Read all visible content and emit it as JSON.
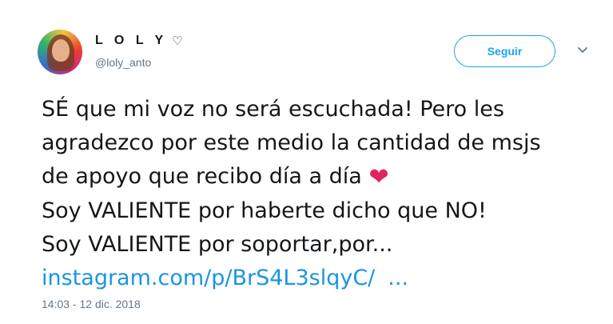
{
  "user": {
    "display_name": "L O L Y",
    "name_suffix_icon": "heart-outline-icon",
    "handle": "@loly_anto"
  },
  "follow_button": {
    "label": "Seguir"
  },
  "menu_icon": "chevron-down-icon",
  "tweet": {
    "lines": [
      "SÉ que mi voz no será escuchada! Pero les",
      "agradezco por este medio la cantidad de msjs",
      "de apoyo que recibo día a día",
      "Soy VALIENTE por haberte dicho que NO!",
      "Soy VALIENTE por soportar,por..."
    ],
    "link_text": "instagram.com/p/BrS4L3slqyC/",
    "link_ellipsis": "...",
    "timestamp": "14:03 - 12 dic. 2018"
  },
  "colors": {
    "accent": "#1da1f2",
    "link": "#1b95e0",
    "heart": "#e0245e",
    "muted": "#657786"
  }
}
